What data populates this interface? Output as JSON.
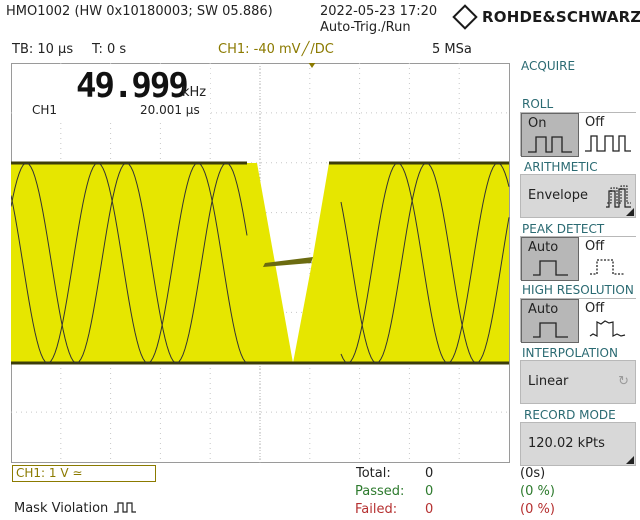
{
  "header": {
    "device": "HMO1002 (HW 0x10180003; SW 05.886)",
    "datetime": "2022-05-23 17:20",
    "trigger_mode": "Auto-Trig./Run",
    "brand": "ROHDE&SCHWARZ"
  },
  "info_bar": {
    "timebase": "TB: 10 µs",
    "trigger_time": "T: 0 s",
    "ch1_trigger": "CH1: -40 mV",
    "coupling": "/DC",
    "sample_rate": "5 MSa"
  },
  "measurement": {
    "frequency": "49.999",
    "frequency_unit": "kHz",
    "channel": "CH1",
    "period": "20.001 µs"
  },
  "channel_box": {
    "label": "CH1: 1 V ≃"
  },
  "mask": {
    "label": "Mask Violation"
  },
  "stats": {
    "total_label": "Total:",
    "total_value": "0",
    "total_pct": "(0s)",
    "passed_label": "Passed:",
    "passed_value": "0",
    "passed_pct": "(0 %)",
    "failed_label": "Failed:",
    "failed_value": "0",
    "failed_pct": "(0 %)"
  },
  "sidebar": {
    "title": "ACQUIRE",
    "roll": {
      "title": "ROLL",
      "left": "On",
      "right": "Off",
      "selected": "left"
    },
    "arithmetic": {
      "title": "ARITHMETIC",
      "value": "Envelope"
    },
    "peak_detect": {
      "title": "PEAK DETECT",
      "left": "Auto",
      "right": "Off",
      "selected": "left"
    },
    "high_resolution": {
      "title": "HIGH RESOLUTION",
      "left": "Auto",
      "right": "Off",
      "selected": "left"
    },
    "interpolation": {
      "title": "INTERPOLATION",
      "value": "Linear"
    },
    "record_mode": {
      "title": "RECORD MODE",
      "value": "120.02 kPts"
    }
  },
  "colors": {
    "waveform_fill": "#e6e600",
    "waveform_dark": "#3d3d0a",
    "grid": "#c8c8c8",
    "sidebar_title": "#2a6a72",
    "olive_text": "#8b7a00"
  }
}
